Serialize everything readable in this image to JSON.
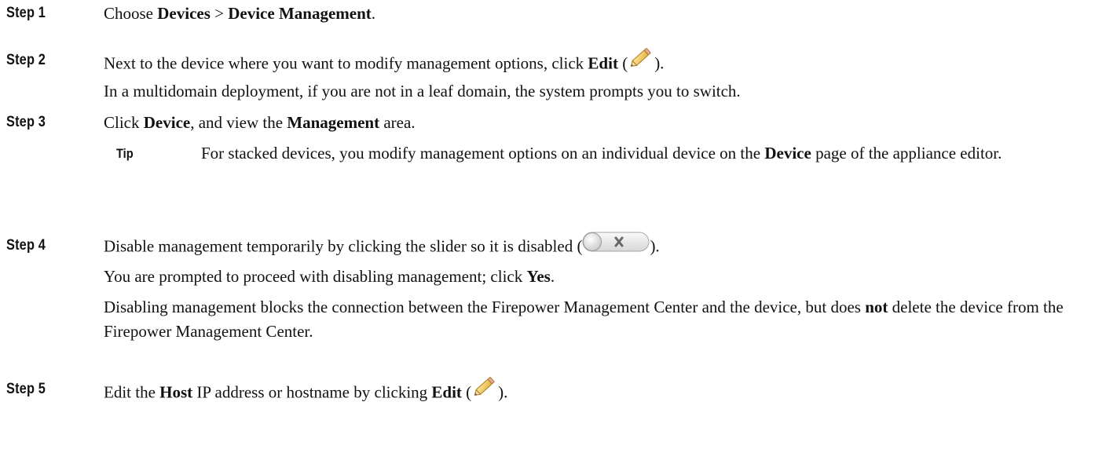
{
  "steps": [
    {
      "label": "Step 1",
      "line": {
        "t1": "Choose ",
        "b1": "Devices",
        "t2": " > ",
        "b2": "Device Management",
        "t3": "."
      }
    },
    {
      "label": "Step 2",
      "line": {
        "t1": "Next to the device where you want to modify management options, click ",
        "b1": "Edit",
        "t2": " (",
        "t3": ")."
      },
      "note": "In a multidomain deployment, if you are not in a leaf domain, the system prompts you to switch."
    },
    {
      "label": "Step 3",
      "line": {
        "t1": "Click ",
        "b1": "Device",
        "t2": ", and view the ",
        "b2": "Management",
        "t3": " area."
      },
      "tip": {
        "label": "Tip",
        "t1": "For stacked devices, you modify management options on an individual device on the ",
        "b1": "Device",
        "t2": " page of the appliance editor."
      }
    },
    {
      "label": "Step 4",
      "line": {
        "t1": "Disable management temporarily by clicking the slider so it is disabled (",
        "t2": ")."
      },
      "prompt": {
        "t1": "You are prompted to proceed with disabling management; click ",
        "b1": "Yes",
        "t2": "."
      },
      "warning": {
        "t1": "Disabling management blocks the connection between the Firepower Management Center and the device, but does ",
        "b1": "not",
        "t2": " delete the device from the Firepower Management Center."
      }
    },
    {
      "label": "Step 5",
      "line": {
        "t1": "Edit the ",
        "b1": "Host",
        "t2": " IP address or hostname by clicking ",
        "b2": "Edit",
        "t3": " (",
        "t4": ")."
      }
    }
  ],
  "icons": {
    "edit": "pencil-icon",
    "toggle": "slider-disabled-icon"
  }
}
